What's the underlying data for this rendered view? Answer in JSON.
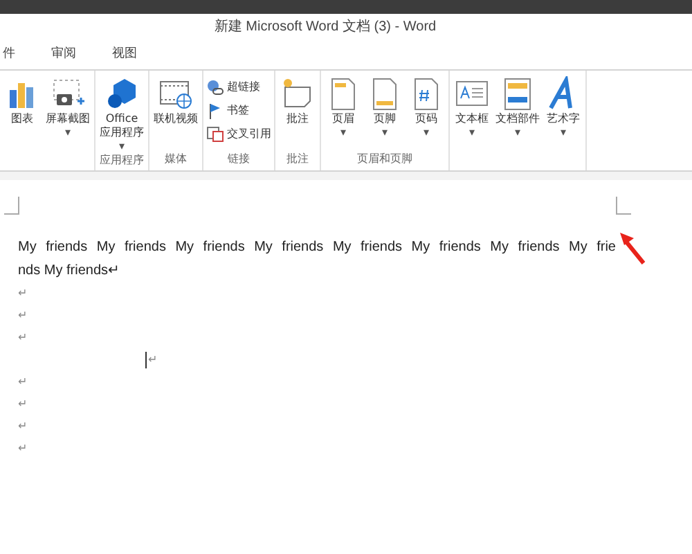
{
  "window": {
    "title": "新建 Microsoft Word 文档 (3) - Word"
  },
  "tabs": [
    {
      "label": "件",
      "selected": false
    },
    {
      "label": "审阅",
      "selected": false
    },
    {
      "label": "视图",
      "selected": false
    }
  ],
  "ribbon": {
    "groups": [
      {
        "buttons": [
          {
            "kind": "large",
            "label": "图表"
          },
          {
            "kind": "large",
            "label": "屏幕截图",
            "caret": "▾"
          }
        ]
      },
      {
        "label": "应用程序",
        "buttons": [
          {
            "kind": "large",
            "label": "Office",
            "label2": "应用程序",
            "caret": "▾"
          }
        ]
      },
      {
        "label": "媒体",
        "buttons": [
          {
            "kind": "large",
            "label": "联机视频"
          }
        ]
      },
      {
        "label": "链接",
        "buttons": [
          {
            "kind": "small",
            "label": "超链接"
          },
          {
            "kind": "small",
            "label": "书签"
          },
          {
            "kind": "small",
            "label": "交叉引用"
          }
        ]
      },
      {
        "label": "批注",
        "buttons": [
          {
            "kind": "large",
            "label": "批注"
          }
        ]
      },
      {
        "label": "页眉和页脚",
        "buttons": [
          {
            "kind": "large",
            "label": "页眉",
            "caret": "▾"
          },
          {
            "kind": "large",
            "label": "页脚",
            "caret": "▾"
          },
          {
            "kind": "large",
            "label": "页码",
            "caret": "▾"
          }
        ]
      },
      {
        "buttons": [
          {
            "kind": "large",
            "label": "文本框",
            "caret": "▾"
          },
          {
            "kind": "large",
            "label": "文档部件",
            "caret": "▾"
          },
          {
            "kind": "large",
            "label": "艺术字",
            "caret": "▾"
          }
        ]
      }
    ]
  },
  "document": {
    "paragraphs": [
      {
        "kind": "text",
        "lines": [
          "My friends My friends My friends My friends My friends My friends My friends My frie",
          "nds My friends↵"
        ]
      },
      {
        "kind": "empty",
        "mark": "↵"
      },
      {
        "kind": "empty",
        "mark": "↵"
      },
      {
        "kind": "empty",
        "mark": "↵"
      },
      {
        "kind": "caret",
        "mark": "↵"
      },
      {
        "kind": "empty",
        "mark": "↵"
      },
      {
        "kind": "empty",
        "mark": "↵"
      },
      {
        "kind": "empty",
        "mark": "↵"
      },
      {
        "kind": "empty",
        "mark": "↵"
      }
    ]
  }
}
